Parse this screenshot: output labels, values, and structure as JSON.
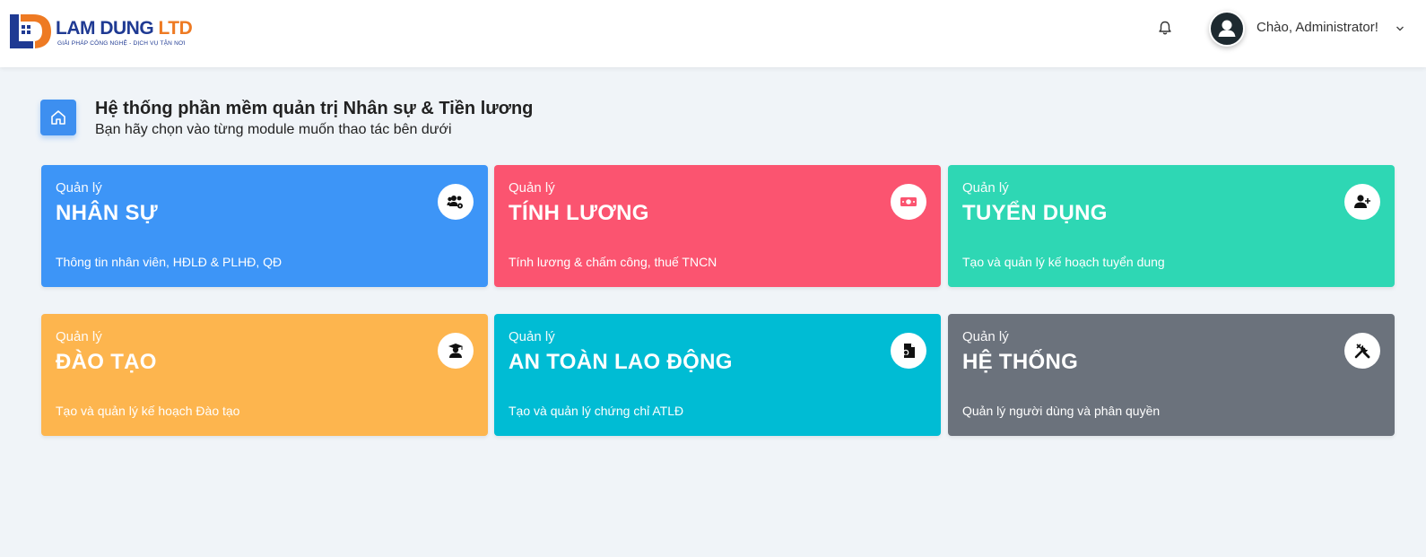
{
  "colors": {
    "primary": "#3d8ff0",
    "card_nhan_su": "#3d95f7",
    "card_tinh_luong": "#fb5470",
    "card_tuyen_dung": "#2ed7b4",
    "card_dao_tao": "#fdb54e",
    "card_an_toan": "#00bcd4",
    "card_he_thong": "#6b727c",
    "logo_blue": "#1f3a93",
    "logo_orange": "#ee7a23"
  },
  "header": {
    "logo_name_main": "LAM DUNG",
    "logo_name_suffix": "LTD",
    "logo_tagline": "GIẢI PHÁP CÔNG NGHỆ - DỊCH VỤ TẬN NƠI",
    "greeting": "Chào, Administrator!",
    "icons": [
      "bell-icon",
      "user-avatar-icon",
      "chevron-down-icon"
    ]
  },
  "page": {
    "title": "Hệ thống phần mềm quản trị Nhân sự & Tiền lương",
    "subtitle": "Bạn hãy chọn vào từng module muốn thao tác bên dưới",
    "icon": "home-icon"
  },
  "modules": [
    {
      "label": "Quản lý",
      "title": "NHÂN SỰ",
      "description": "Thông tin nhân viên, HĐLĐ & PLHĐ, QĐ",
      "icon": "users-cog-icon"
    },
    {
      "label": "Quản lý",
      "title": "TÍNH LƯƠNG",
      "description": "Tính lương & chấm công, thuế TNCN",
      "icon": "money-bill-icon"
    },
    {
      "label": "Quản lý",
      "title": "TUYỂN DỤNG",
      "description": "Tạo và quản lý kế hoạch tuyển dung",
      "icon": "user-plus-icon"
    },
    {
      "label": "Quản lý",
      "title": "ĐÀO TẠO",
      "description": "Tạo và quản lý kế hoạch Đào tạo",
      "icon": "graduate-icon"
    },
    {
      "label": "Quản lý",
      "title": "AN TOÀN LAO ĐỘNG",
      "description": "Tạo và quản lý chứng chỉ ATLĐ",
      "icon": "certificate-file-icon"
    },
    {
      "label": "Quản lý",
      "title": "HỆ THỐNG",
      "description": "Quản lý người dùng và phân quyền",
      "icon": "tools-icon"
    }
  ]
}
